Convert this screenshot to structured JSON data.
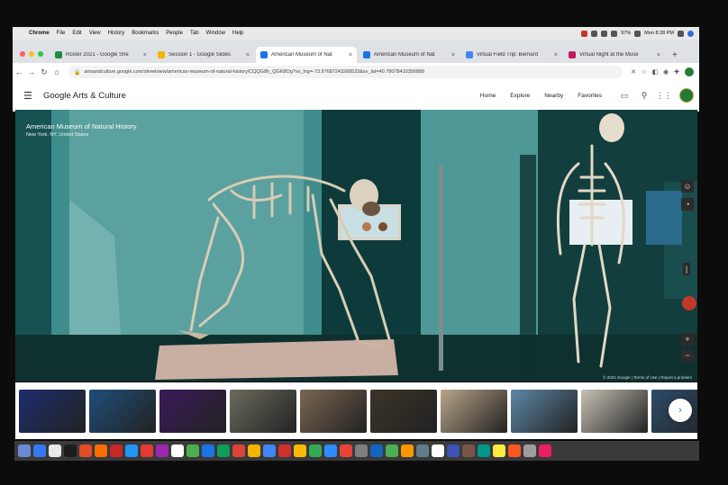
{
  "menubar": {
    "app": "Chrome",
    "items": [
      "File",
      "Edit",
      "View",
      "History",
      "Bookmarks",
      "People",
      "Tab",
      "Window",
      "Help"
    ],
    "battery": "97%",
    "clock": "Mon 8:28 PM"
  },
  "tabs": [
    {
      "title": "Roster 2021 - Google She",
      "color": "#1e8e3e",
      "active": false
    },
    {
      "title": "Session 1 - Google Slides",
      "color": "#f4b400",
      "active": false
    },
    {
      "title": "American Museum of Nat",
      "color": "#1a73e8",
      "active": true
    },
    {
      "title": "American Museum of Nat",
      "color": "#1a73e8",
      "active": false
    },
    {
      "title": "Virtual Field Trip: Bernard",
      "color": "#4285f4",
      "active": false
    },
    {
      "title": "Virtual Night at the Muse",
      "color": "#c2185b",
      "active": false
    }
  ],
  "omnibox": {
    "url": "artsandculture.google.com/streetview/american-museum-of-natural-history/CQQG8h_QGK8Og?sv_lng=-73.97687243268533&sv_lat=40.78078410356889"
  },
  "gac": {
    "logo": "Google Arts & Culture",
    "nav": [
      "Home",
      "Explore",
      "Nearby",
      "Favorites"
    ]
  },
  "streetview": {
    "title": "American Museum of Natural History",
    "subtitle": "New York, NY, United States",
    "footer": "© 2021 Google | Terms of Use | Report a problem"
  },
  "thumbnails": [
    {
      "name": "thumb-1",
      "color": "#1d2d6e"
    },
    {
      "name": "thumb-2",
      "color": "#1f4e79"
    },
    {
      "name": "thumb-3",
      "color": "#3a1a5a"
    },
    {
      "name": "thumb-4",
      "color": "#6b6b5e"
    },
    {
      "name": "thumb-5",
      "color": "#7a6650"
    },
    {
      "name": "thumb-6",
      "color": "#3b3428"
    },
    {
      "name": "thumb-7",
      "color": "#b9a58a"
    },
    {
      "name": "thumb-8",
      "color": "#5d87a6"
    },
    {
      "name": "thumb-9",
      "color": "#c7c2b5"
    },
    {
      "name": "thumb-10",
      "color": "#2c4c6a"
    }
  ],
  "dock": [
    "#6a8ad8",
    "#3478f6",
    "#e8e8e8",
    "#1d1d1d",
    "#e34c26",
    "#ff6d00",
    "#c62828",
    "#2196f3",
    "#e53935",
    "#9c27b0",
    "#ffffff",
    "#4caf50",
    "#1a73e8",
    "#0f9d58",
    "#db4437",
    "#f4b400",
    "#4285f4",
    "#d32f2f",
    "#fbbc05",
    "#34a853",
    "#2d8cff",
    "#ea4335",
    "#7f7f7f",
    "#1565c0",
    "#4caf50",
    "#ff9800",
    "#607d8b",
    "#ffffff",
    "#3f51b5",
    "#795548",
    "#009688",
    "#ffeb3b",
    "#ff5722",
    "#9e9e9e",
    "#e91e63"
  ],
  "colors": {
    "chrome_bg": "#dee1e6",
    "accent_blue": "#1a73e8"
  }
}
